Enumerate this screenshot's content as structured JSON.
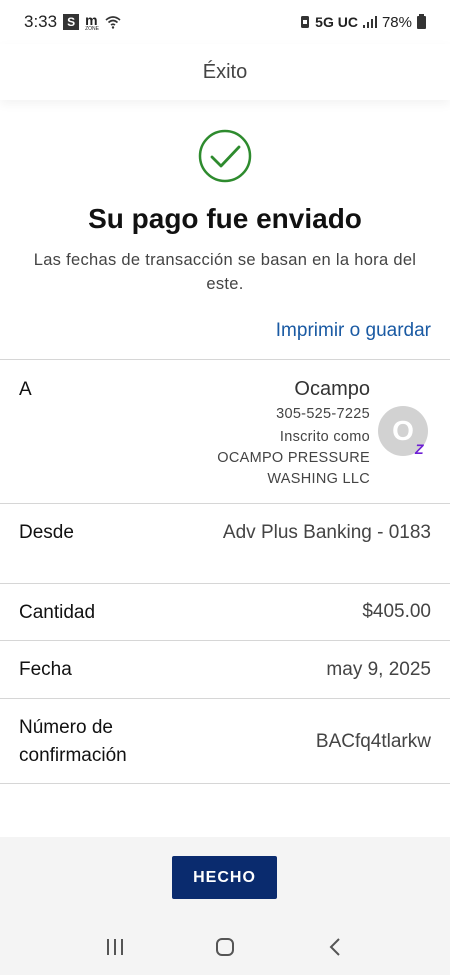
{
  "status_bar": {
    "time": "3:33",
    "app_badge_s": "S",
    "app_badge_m": "m",
    "app_badge_m_sub": "ZONE",
    "network": "5G UC",
    "battery": "78%"
  },
  "header": {
    "title": "Éxito"
  },
  "success": {
    "title": "Su pago fue enviado",
    "subtitle": "Las fechas de transacción se basan en la hora del este.",
    "print_link": "Imprimir o guardar",
    "check_color": "#2e8b2e"
  },
  "details": {
    "to": {
      "label": "A",
      "name": "Ocampo",
      "phone": "305-525-7225",
      "enrolled_as": "Inscrito como",
      "business_line1": "OCAMPO PRESSURE",
      "business_line2": "WASHING LLC",
      "avatar_initial": "O",
      "zelle_badge": "Z"
    },
    "from": {
      "label": "Desde",
      "value": "Adv Plus Banking - 0183"
    },
    "amount": {
      "label": "Cantidad",
      "value": "$405.00"
    },
    "date": {
      "label": "Fecha",
      "value": "may 9, 2025"
    },
    "confirmation": {
      "label_line1": "Número de",
      "label_line2": "confirmación",
      "value": "BACfq4tlarkw"
    }
  },
  "footer": {
    "done_label": "HECHO"
  },
  "colors": {
    "link": "#1a5aa3",
    "button": "#0a2b6e",
    "zelle": "#6d1ed4"
  },
  "nav": {
    "icons": [
      "recent-apps-icon",
      "home-icon",
      "back-icon"
    ]
  }
}
